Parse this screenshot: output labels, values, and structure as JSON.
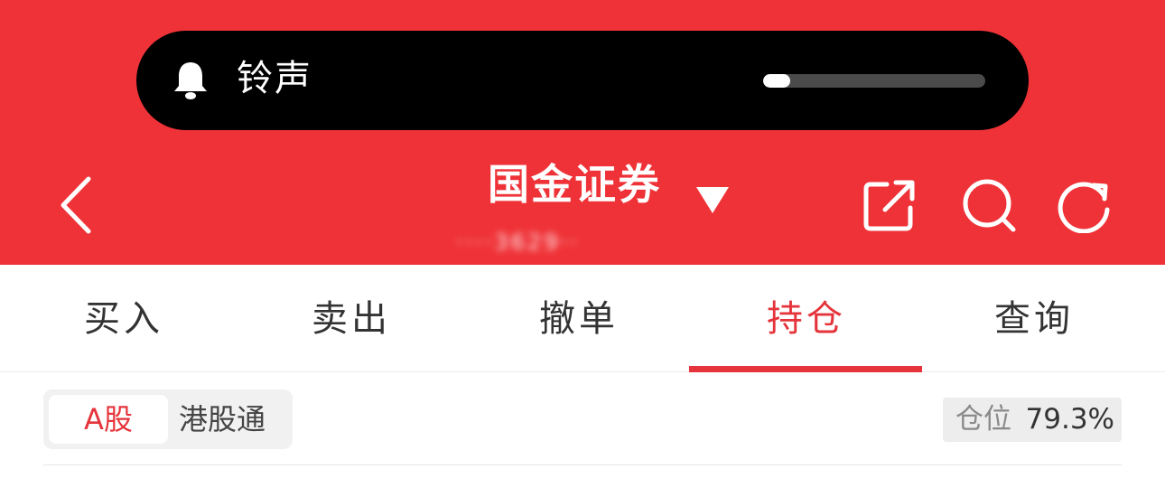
{
  "status_overlay": {
    "label": "铃声",
    "icon": "bell-icon",
    "volume_fraction": 0.12
  },
  "header": {
    "title": "国金证券",
    "subtitle_obscured": "····3629··",
    "icons": [
      "back-icon",
      "caret-down-icon",
      "share-icon",
      "search-icon",
      "refresh-icon"
    ],
    "background": "#ef3237"
  },
  "tabs": [
    {
      "label": "买入",
      "active": false
    },
    {
      "label": "卖出",
      "active": false
    },
    {
      "label": "撤单",
      "active": false
    },
    {
      "label": "持仓",
      "active": true
    },
    {
      "label": "查询",
      "active": false
    }
  ],
  "market_switch": {
    "options": [
      "A股",
      "港股通"
    ],
    "selected": "A股"
  },
  "position": {
    "label": "仓位",
    "value": "79.3%"
  },
  "colors": {
    "accent": "#e5343b",
    "header": "#ef3237"
  }
}
